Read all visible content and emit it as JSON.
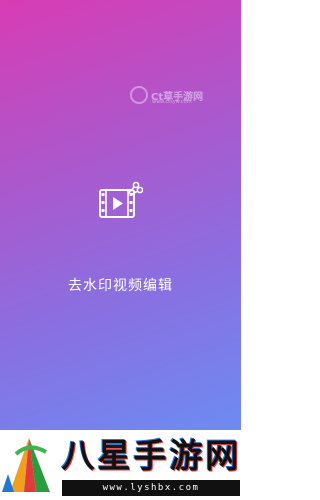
{
  "splash": {
    "title": "去水印视频编辑",
    "icon": "video-scissors-icon"
  },
  "watermark": {
    "text": "Ct草手游网",
    "subtext": "www.ctsyw.com",
    "icon": "watermark-logo-icon"
  },
  "banner": {
    "name_chars": [
      "八",
      "星",
      "手",
      "游",
      "网"
    ],
    "url": "www.lyshbx.com",
    "logo_icon": "colorful-tent-logo-icon"
  },
  "colors": {
    "gradient_top": "#d83cb4",
    "gradient_bottom": "#6d8bf2",
    "title_text": "#ffffff"
  }
}
